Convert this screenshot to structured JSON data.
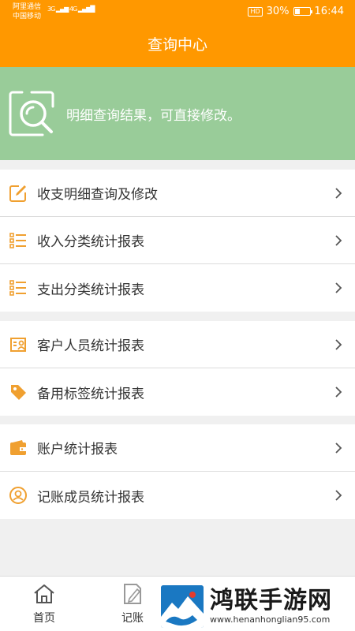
{
  "status": {
    "carrier1": "阿里通信",
    "carrier2": "中国移动",
    "net1": "3G",
    "net2": "4G",
    "hd": "HD",
    "battery": "30%",
    "time": "16:44"
  },
  "header": {
    "title": "查询中心"
  },
  "banner": {
    "text": "明细查询结果，可直接修改。"
  },
  "menu_groups": [
    {
      "items": [
        {
          "label": "收支明细查询及修改",
          "icon": "edit-icon"
        },
        {
          "label": "收入分类统计报表",
          "icon": "list-icon"
        },
        {
          "label": "支出分类统计报表",
          "icon": "list-icon"
        }
      ]
    },
    {
      "items": [
        {
          "label": "客户人员统计报表",
          "icon": "contact-card-icon"
        },
        {
          "label": "备用标签统计报表",
          "icon": "tag-icon"
        }
      ]
    },
    {
      "items": [
        {
          "label": "账户统计报表",
          "icon": "wallet-icon"
        },
        {
          "label": "记账成员统计报表",
          "icon": "user-circle-icon"
        }
      ]
    }
  ],
  "tabbar": {
    "home_label": "首页",
    "record_label": "记账"
  },
  "watermark": {
    "title": "鸿联手游网",
    "url": "www.henanhonglian95.com"
  },
  "colors": {
    "accent": "#ff9800",
    "banner": "#99cc99",
    "icon": "#f0a030"
  }
}
